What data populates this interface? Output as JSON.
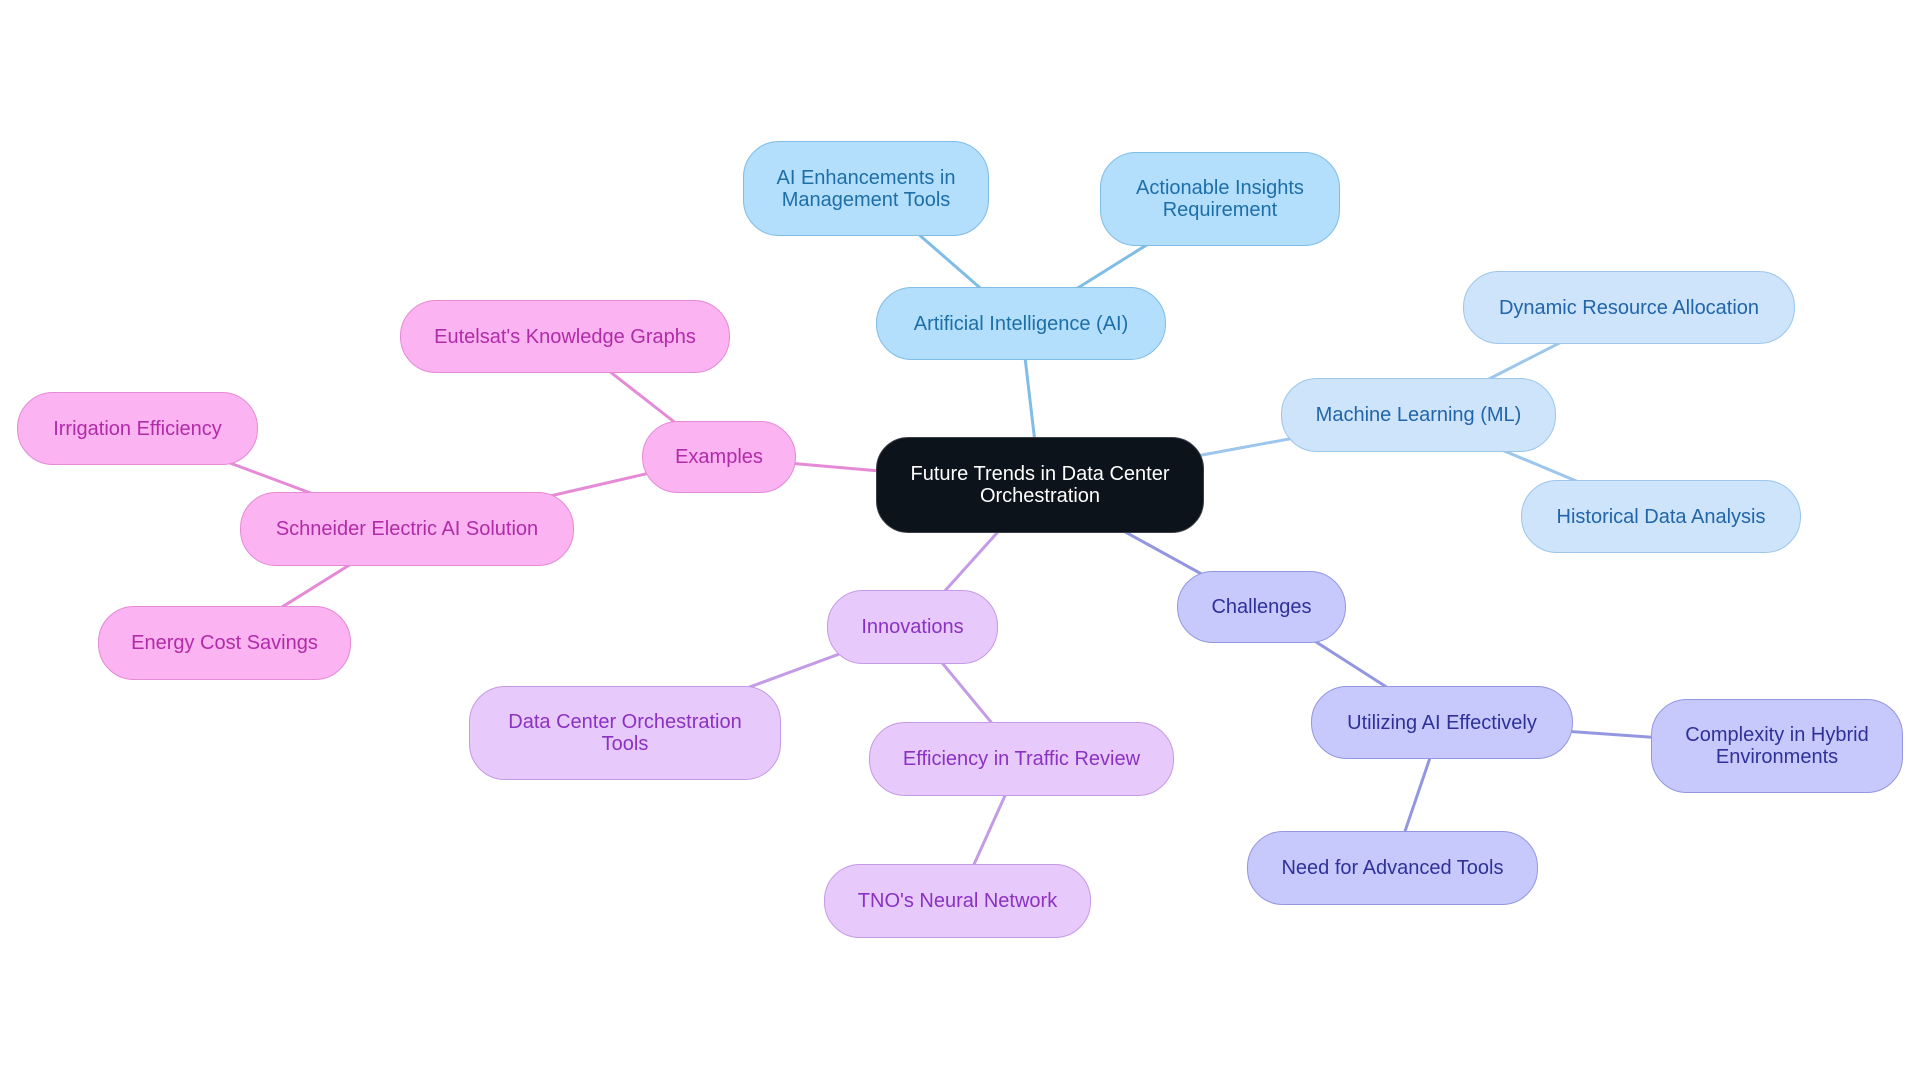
{
  "title": "Future Trends in Data Center Orchestration",
  "colors": {
    "root_fill": "#0d131a",
    "ai_branch": "#7fbde6",
    "ml_branch": "#9cc6ec",
    "challenges_branch": "#9397e0",
    "innovations_branch": "#c49be6",
    "examples_branch": "#e58ad6"
  },
  "nodes": {
    "root": {
      "label": "Future Trends in Data Center Orchestration"
    },
    "ai": {
      "label": "Artificial Intelligence (AI)"
    },
    "ai_enh": {
      "label": "AI Enhancements in Management Tools"
    },
    "actionable": {
      "label": "Actionable Insights Requirement"
    },
    "ml": {
      "label": "Machine Learning (ML)"
    },
    "dynamic": {
      "label": "Dynamic Resource Allocation"
    },
    "historical": {
      "label": "Historical Data Analysis"
    },
    "challenges": {
      "label": "Challenges"
    },
    "utilizing": {
      "label": "Utilizing AI Effectively"
    },
    "complexity": {
      "label": "Complexity in Hybrid Environments"
    },
    "advanced": {
      "label": "Need for Advanced Tools"
    },
    "innovations": {
      "label": "Innovations"
    },
    "dc_tools": {
      "label": "Data Center Orchestration Tools"
    },
    "traffic": {
      "label": "Efficiency in Traffic Review"
    },
    "tno": {
      "label": "TNO's Neural Network"
    },
    "examples": {
      "label": "Examples"
    },
    "eutelsat": {
      "label": "Eutelsat's Knowledge Graphs"
    },
    "schneider": {
      "label": "Schneider Electric AI Solution"
    },
    "irrigation": {
      "label": "Irrigation Efficiency"
    },
    "energy": {
      "label": "Energy Cost Savings"
    }
  },
  "edges": [
    [
      "root",
      "ai"
    ],
    [
      "ai",
      "ai_enh"
    ],
    [
      "ai",
      "actionable"
    ],
    [
      "root",
      "ml"
    ],
    [
      "ml",
      "dynamic"
    ],
    [
      "ml",
      "historical"
    ],
    [
      "root",
      "challenges"
    ],
    [
      "challenges",
      "utilizing"
    ],
    [
      "utilizing",
      "complexity"
    ],
    [
      "utilizing",
      "advanced"
    ],
    [
      "root",
      "innovations"
    ],
    [
      "innovations",
      "dc_tools"
    ],
    [
      "innovations",
      "traffic"
    ],
    [
      "traffic",
      "tno"
    ],
    [
      "root",
      "examples"
    ],
    [
      "examples",
      "eutelsat"
    ],
    [
      "examples",
      "schneider"
    ],
    [
      "schneider",
      "irrigation"
    ],
    [
      "schneider",
      "energy"
    ]
  ]
}
